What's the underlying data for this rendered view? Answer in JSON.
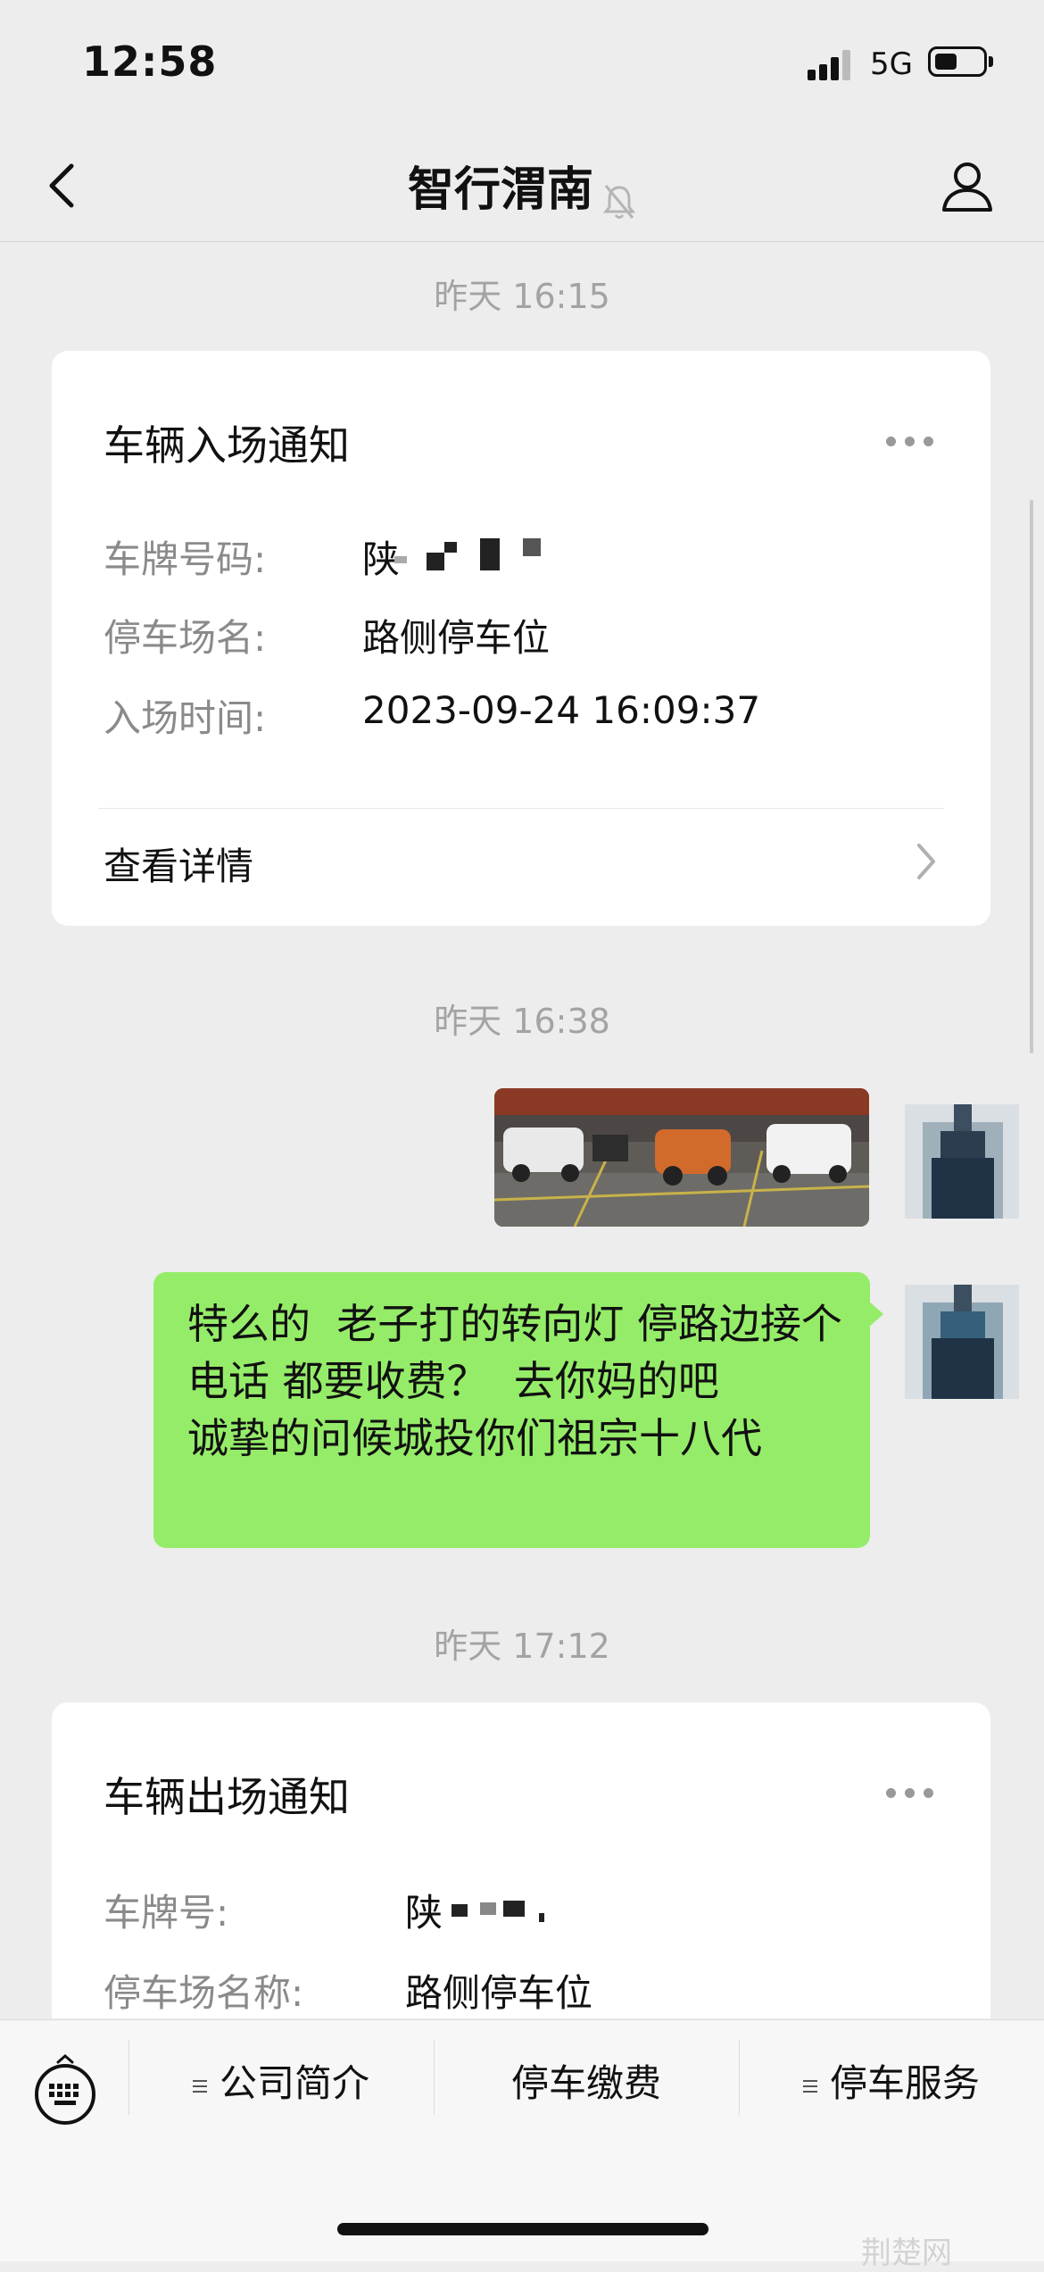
{
  "status_bar": {
    "time": "12:58",
    "network": "5G"
  },
  "nav": {
    "title": "智行渭南"
  },
  "chat": {
    "ts1": "昨天 16:15",
    "entry_card": {
      "title": "车辆入场通知",
      "rows": [
        {
          "label": "车牌号码:",
          "value": ""
        },
        {
          "label": "停车场名:",
          "value": "路侧停车位"
        },
        {
          "label": "入场时间:",
          "value": "2023-09-24 16:09:37"
        }
      ],
      "plate_prefix": "陕",
      "detail": "查看详情"
    },
    "ts2": "昨天 16:38",
    "message": "特么的  老子打的转向灯 停路边接个电话 都要收费？  去你妈的吧\n诚挚的问候城投你们祖宗十八代",
    "ts3": "昨天 17:12",
    "exit_card": {
      "title": "车辆出场通知",
      "rows": [
        {
          "label": "车牌号:",
          "value": ""
        },
        {
          "label": "停车场名称:",
          "value": "路侧停车位"
        }
      ],
      "plate_prefix": "陕"
    }
  },
  "menu": {
    "items": [
      "公司简介",
      "停车缴费",
      "停车服务"
    ]
  },
  "watermark": "荆楚网"
}
